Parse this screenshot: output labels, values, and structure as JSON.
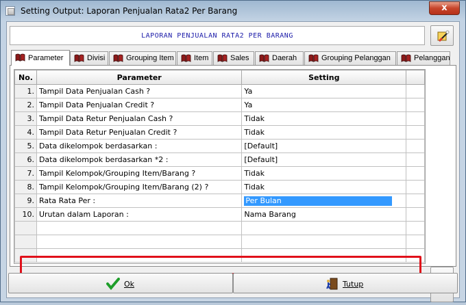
{
  "window": {
    "title": "Setting Output: Laporan Penjualan Rata2 Per Barang",
    "close_label": "x"
  },
  "header": {
    "report_title": "LAPORAN PENJUALAN RATA2 PER BARANG"
  },
  "tabs": [
    {
      "label": "Parameter",
      "active": true
    },
    {
      "label": "Divisi",
      "active": false
    },
    {
      "label": "Grouping Item",
      "active": false
    },
    {
      "label": "Item",
      "active": false
    },
    {
      "label": "Sales",
      "active": false
    },
    {
      "label": "Daerah",
      "active": false
    },
    {
      "label": "Grouping Pelanggan",
      "active": false
    },
    {
      "label": "Pelanggan",
      "active": false
    }
  ],
  "grid": {
    "columns": {
      "no": "No.",
      "parameter": "Parameter",
      "setting": "Setting"
    },
    "rows": [
      {
        "no": "1.",
        "parameter": "Tampil Data Penjualan Cash ?",
        "setting": "Ya"
      },
      {
        "no": "2.",
        "parameter": "Tampil Data Penjualan Credit ?",
        "setting": "Ya"
      },
      {
        "no": "3.",
        "parameter": "Tampil Data Retur Penjualan Cash ?",
        "setting": "Tidak"
      },
      {
        "no": "4.",
        "parameter": "Tampil Data Retur Penjualan Credit ?",
        "setting": "Tidak"
      },
      {
        "no": "5.",
        "parameter": "Data dikelompok berdasarkan :",
        "setting": "[Default]"
      },
      {
        "no": "6.",
        "parameter": "Data dikelompok berdasarkan *2 :",
        "setting": "[Default]"
      },
      {
        "no": "7.",
        "parameter": "Tampil Kelompok/Grouping Item/Barang ?",
        "setting": "Tidak"
      },
      {
        "no": "8.",
        "parameter": "Tampil Kelompok/Grouping Item/Barang (2) ?",
        "setting": "Tidak"
      },
      {
        "no": "9.",
        "parameter": "Rata Rata Per :",
        "setting": "Per Bulan"
      },
      {
        "no": "10.",
        "parameter": "Urutan dalam Laporan :",
        "setting": "Nama Barang"
      }
    ]
  },
  "buttons": {
    "ok": "Ok",
    "tutup": "Tutup"
  },
  "colors": {
    "selection": "#3399ff",
    "highlight_border": "#e0101a",
    "report_title": "#1a1aa8"
  }
}
